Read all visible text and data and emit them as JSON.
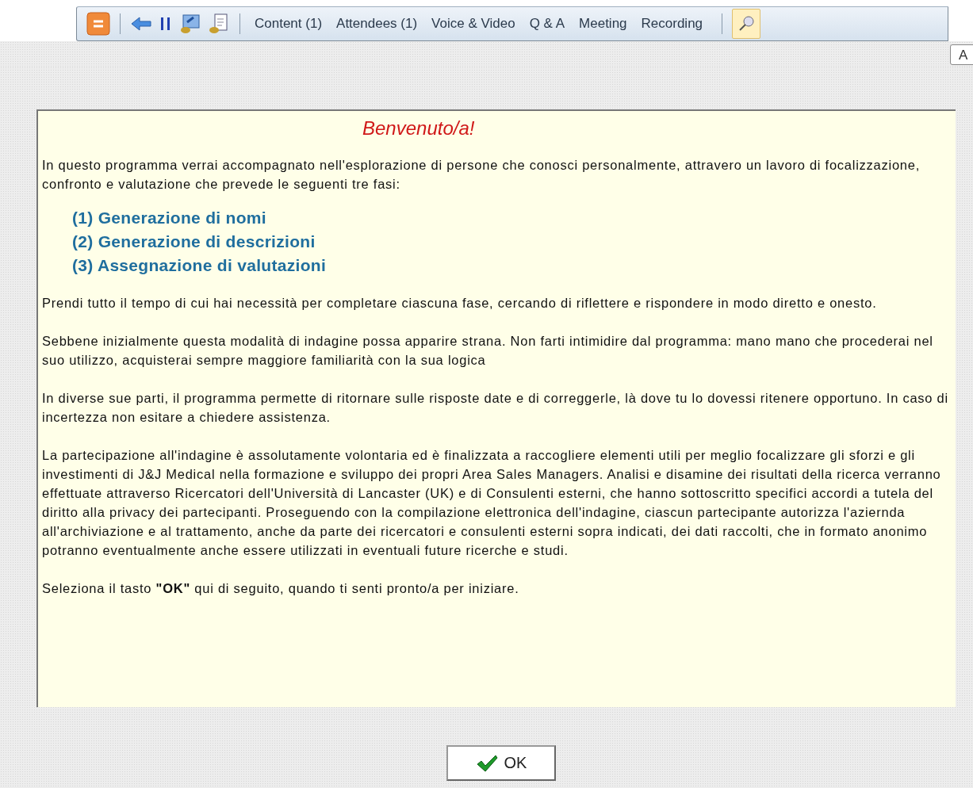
{
  "toolbar": {
    "tabs": [
      {
        "label": "Content (1)",
        "selected": false
      },
      {
        "label": "Attendees (1)",
        "selected": false
      },
      {
        "label": "Voice & Video",
        "selected": false
      },
      {
        "label": "Q & A",
        "selected": false
      },
      {
        "label": "Meeting",
        "selected": false
      },
      {
        "label": "Recording",
        "selected": false
      }
    ],
    "pin": {
      "on": true
    },
    "tooltip": "A"
  },
  "panel": {
    "title": "Benvenuto/a!",
    "intro": "In questo programma verrai accompagnato nell'esplorazione di persone che conosci personalmente, attravero un lavoro di focalizzazione, confronto e valutazione che prevede le seguenti tre fasi:",
    "phases": [
      "(1) Generazione di nomi",
      "(2) Generazione di descrizioni",
      "(3) Assegnazione di valutazioni"
    ],
    "paragraphs": [
      "Prendi tutto il tempo di cui hai necessità per completare ciascuna fase, cercando di riflettere e rispondere in modo diretto e onesto.",
      "Sebbene inizialmente questa modalità di indagine possa apparire strana. Non farti intimidire dal programma: mano mano che procederai nel suo utilizzo, acquisterai sempre maggiore familiarità con la sua logica",
      "In diverse sue parti, il programma permette di ritornare sulle risposte date e di correggerle, là dove tu lo dovessi ritenere opportuno. In caso di incertezza non esitare a chiedere assistenza.",
      "La partecipazione all'indagine è assolutamente volontaria ed è finalizzata a raccogliere elementi utili per meglio focalizzare gli sforzi e gli investimenti di J&J Medical nella formazione e sviluppo dei propri Area Sales Managers. Analisi e disamine dei risultati della ricerca verranno effettuate attraverso Ricercatori dell'Università di Lancaster (UK) e di Consulenti esterni, che hanno sottoscritto specifici accordi a tutela del diritto alla privacy dei partecipanti. Proseguendo con la compilazione elettronica dell'indagine, ciascun partecipante autorizza l'aziernda all'archiviazione e al trattamento, anche da parte dei ricercatori e consulenti esterni sopra indicati, dei dati raccolti, che in formato anonimo potranno eventualmente anche essere utilizzati in eventuali future ricerche e studi.",
      "Seleziona il tasto **\"OK\"** qui di seguito, quando ti senti pronto/a per iniziare."
    ]
  },
  "ok_button": {
    "label": "OK"
  }
}
